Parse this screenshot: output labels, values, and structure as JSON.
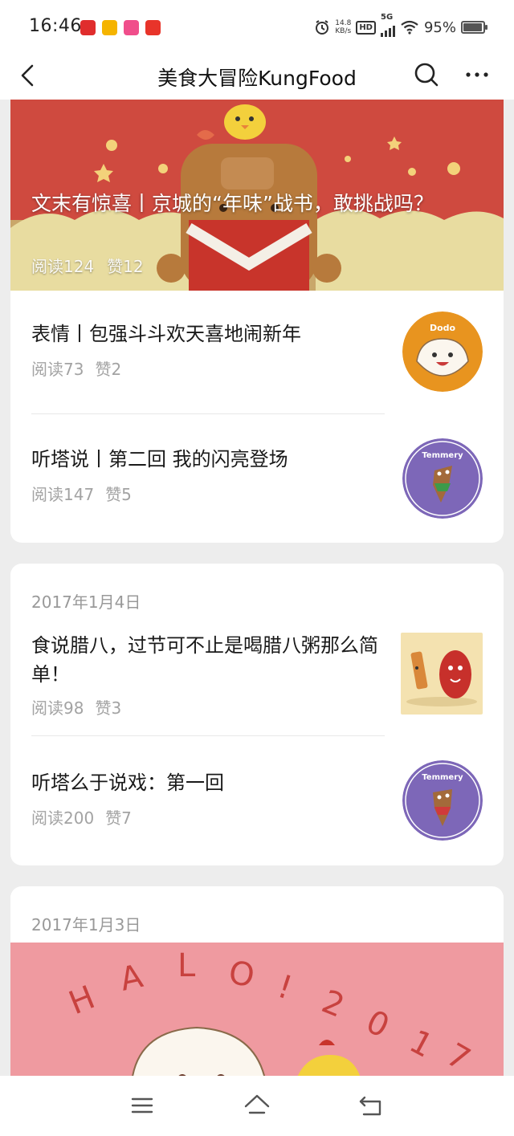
{
  "status_bar": {
    "time": "16:46",
    "net_speed_value": "14.8",
    "net_speed_unit": "KB/s",
    "hd_label": "HD",
    "network": "5G",
    "battery_percent": "95%",
    "battery_level": 0.95,
    "app_icon_colors": [
      "#e02d2d",
      "#f5b400",
      "#f04e8b",
      "#e8342a"
    ]
  },
  "nav": {
    "title": "美食大冒险KungFood",
    "back_icon": "chevron-left-icon",
    "search_icon": "search-icon",
    "more_icon": "more-icon"
  },
  "groups": [
    {
      "date": "",
      "hero": {
        "title": "文末有惊喜丨京城的“年味”战书，敢挑战吗？",
        "reads": "阅读124",
        "likes": "赞12"
      },
      "articles": [
        {
          "title": "表情丨包强斗斗欢天喜地闹新年",
          "reads": "阅读73",
          "likes": "赞2",
          "thumb_badge": "Dodo"
        },
        {
          "title": "听塔说丨第二回 我的闪亮登场",
          "reads": "阅读147",
          "likes": "赞5",
          "thumb_badge": "Temmery"
        }
      ]
    },
    {
      "date": "2017年1月4日",
      "articles": [
        {
          "title": "食说腊八，过节可不止是喝腊八粥那么简单！",
          "reads": "阅读98",
          "likes": "赞3"
        },
        {
          "title": "听塔么于说戏：第一回",
          "reads": "阅读200",
          "likes": "赞7",
          "thumb_badge": "Temmery"
        }
      ]
    },
    {
      "date": "2017年1月3日",
      "hero_art_text": "HALO!2017"
    }
  ],
  "system_nav": {
    "menu_icon": "menu-icon",
    "home_icon": "home-icon",
    "back_icon": "back-icon"
  },
  "colors": {
    "hero_red": "#cf4a3f",
    "hero_gold": "#d9c67a",
    "pink_banner": "#ef9aa0",
    "dodo_orange": "#e8941f",
    "temmery_purple": "#7d67b8"
  }
}
